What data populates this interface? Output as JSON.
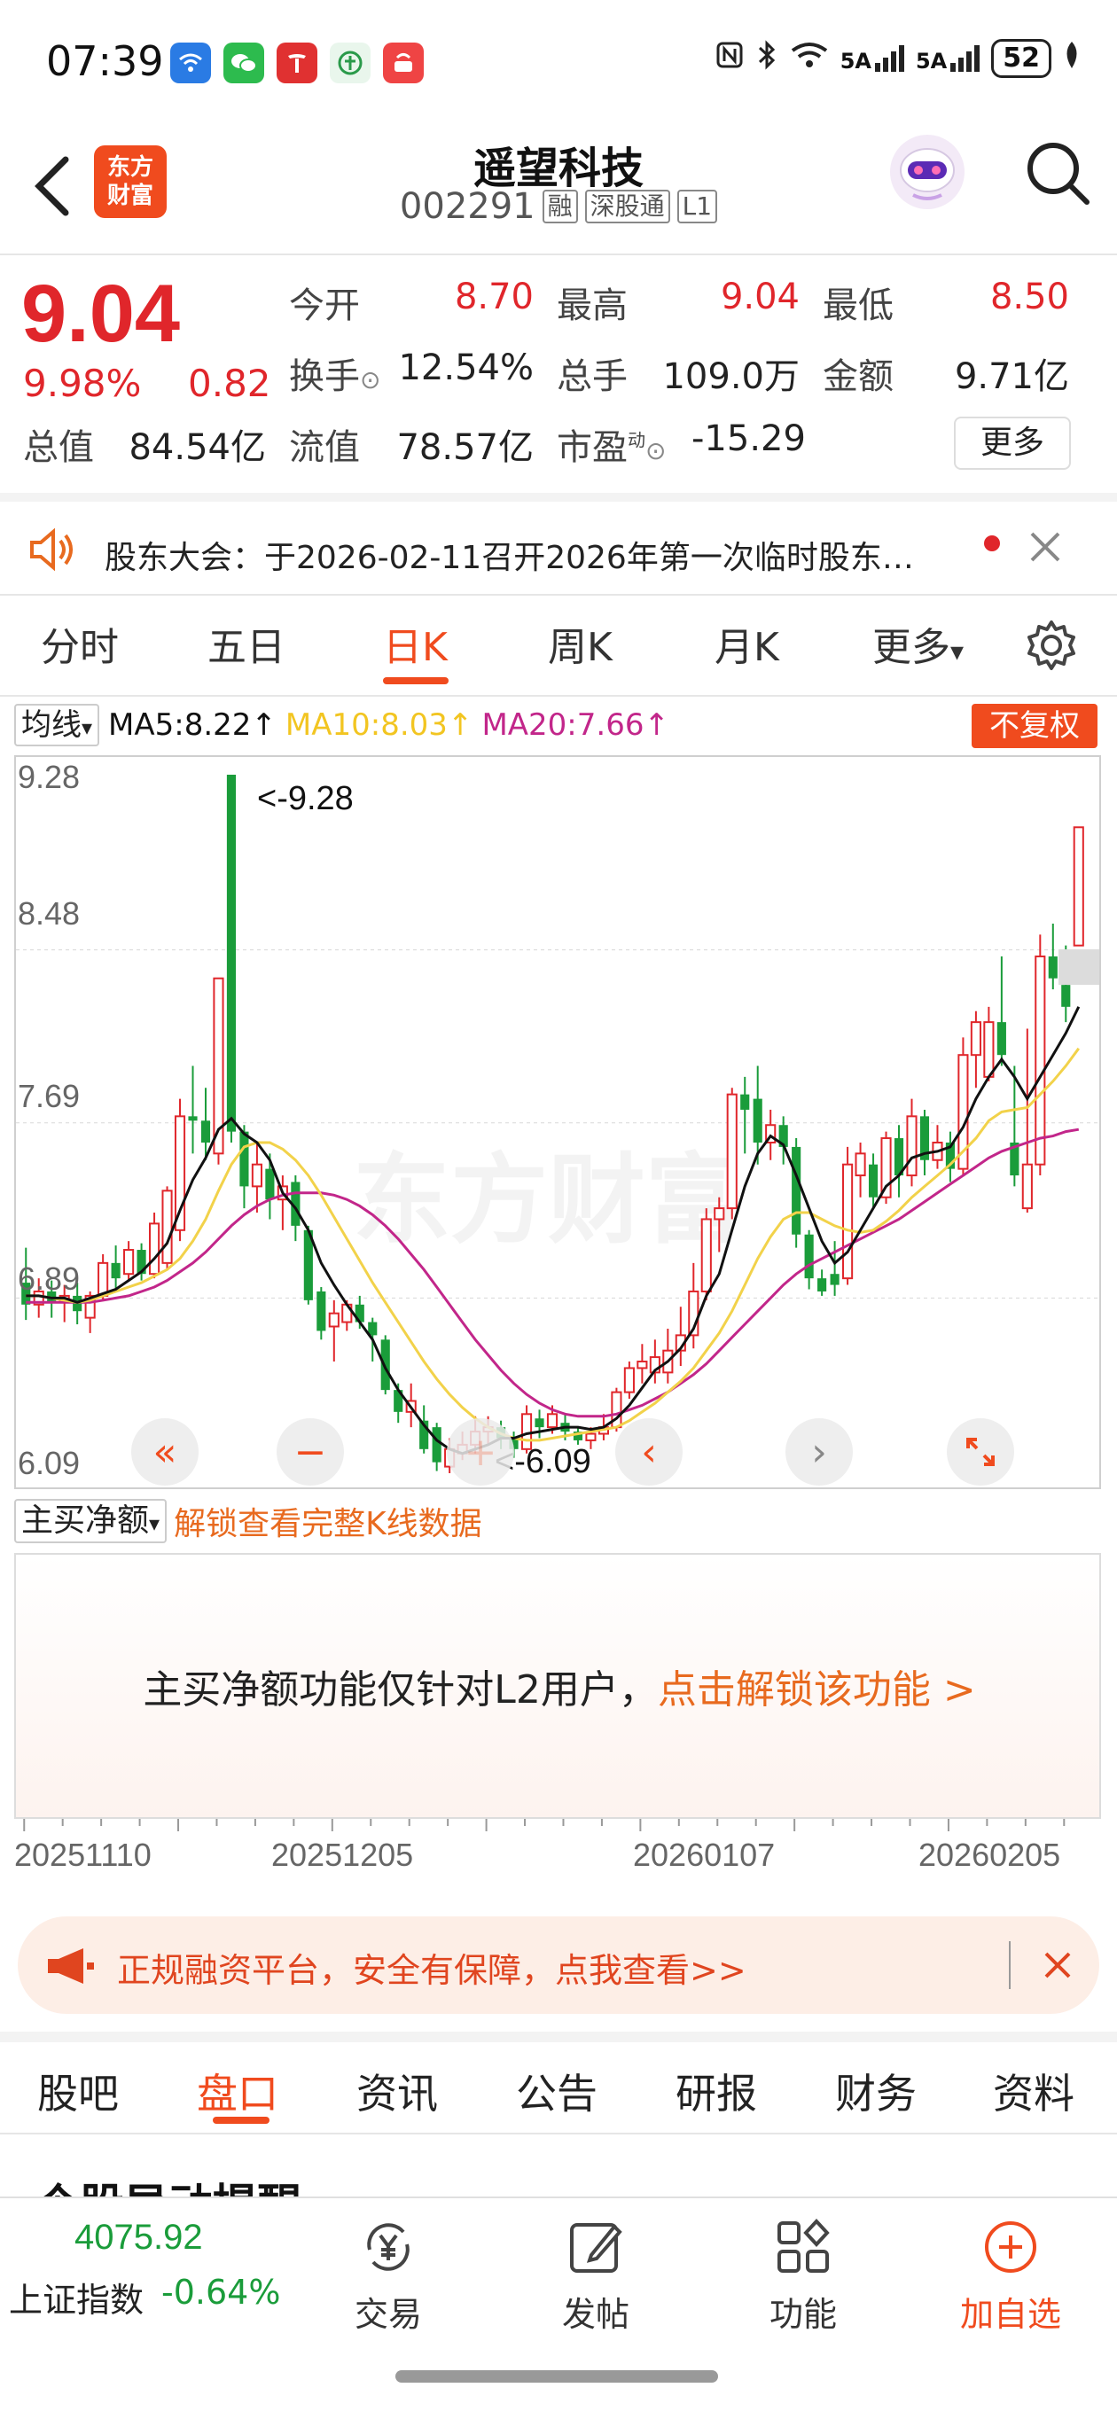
{
  "status_bar": {
    "time": "07:39",
    "network": "5A",
    "battery": "52"
  },
  "header": {
    "brand": "东方财富",
    "stock_name": "遥望科技",
    "stock_code": "002291",
    "tags": [
      "融",
      "深股通",
      "L1"
    ]
  },
  "quote": {
    "price": "9.04",
    "change_pct": "9.98%",
    "change": "0.82",
    "fields": [
      {
        "label": "今开",
        "value": "8.70",
        "color": "red"
      },
      {
        "label": "最高",
        "value": "9.04",
        "color": "red"
      },
      {
        "label": "最低",
        "value": "8.50",
        "color": "red"
      },
      {
        "label": "换手",
        "value": "12.54%",
        "color": "dark"
      },
      {
        "label": "总手",
        "value": "109.0万",
        "color": "dark"
      },
      {
        "label": "金额",
        "value": "9.71亿",
        "color": "dark"
      },
      {
        "label": "总值",
        "value": "84.54亿",
        "color": "dark"
      },
      {
        "label": "流值",
        "value": "78.57亿",
        "color": "dark"
      },
      {
        "label": "市盈",
        "value": "-15.29",
        "color": "dark"
      }
    ],
    "pe_superscript": "动",
    "more_label": "更多"
  },
  "notice": {
    "text": "股东大会：于2026-02-11召开2026年第一次临时股东…"
  },
  "period_tabs": {
    "items": [
      "分时",
      "五日",
      "日K",
      "周K",
      "月K",
      "更多"
    ],
    "active": "日K"
  },
  "ma_row": {
    "select_label": "均线",
    "ma5": "MA5:8.22↑",
    "ma10": "MA10:8.03↑",
    "ma20": "MA20:7.66↑",
    "unadjusted_label": "不复权"
  },
  "chart_data": {
    "type": "candlestick",
    "y_labels": [
      "9.28",
      "8.48",
      "7.69",
      "6.89",
      "6.09"
    ],
    "ylim": [
      6.09,
      9.28
    ],
    "high_annotation": "<-9.28",
    "low_annotation": "<-6.09",
    "candles": [
      {
        "o": 6.96,
        "c": 6.86,
        "h": 7.12,
        "l": 6.79
      },
      {
        "o": 6.86,
        "c": 6.92,
        "h": 6.98,
        "l": 6.8
      },
      {
        "o": 6.92,
        "c": 6.87,
        "h": 6.97,
        "l": 6.8
      },
      {
        "o": 6.87,
        "c": 6.9,
        "h": 6.95,
        "l": 6.78
      },
      {
        "o": 6.9,
        "c": 6.83,
        "h": 6.96,
        "l": 6.77
      },
      {
        "o": 6.8,
        "c": 6.9,
        "h": 6.92,
        "l": 6.73
      },
      {
        "o": 6.9,
        "c": 7.05,
        "h": 7.09,
        "l": 6.88
      },
      {
        "o": 7.05,
        "c": 6.98,
        "h": 7.13,
        "l": 6.92
      },
      {
        "o": 7.0,
        "c": 7.11,
        "h": 7.15,
        "l": 6.97
      },
      {
        "o": 7.11,
        "c": 7.0,
        "h": 7.14,
        "l": 6.97
      },
      {
        "o": 7.0,
        "c": 7.23,
        "h": 7.28,
        "l": 6.98
      },
      {
        "o": 7.05,
        "c": 7.38,
        "h": 7.4,
        "l": 7.02
      },
      {
        "o": 7.2,
        "c": 7.72,
        "h": 7.8,
        "l": 7.15
      },
      {
        "o": 7.72,
        "c": 7.7,
        "h": 7.95,
        "l": 7.55
      },
      {
        "o": 7.7,
        "c": 7.6,
        "h": 7.85,
        "l": 7.52
      },
      {
        "o": 7.55,
        "c": 8.35,
        "h": 8.35,
        "l": 7.5
      },
      {
        "o": 9.28,
        "c": 7.65,
        "h": 9.28,
        "l": 7.6
      },
      {
        "o": 7.65,
        "c": 7.4,
        "h": 7.68,
        "l": 7.3
      },
      {
        "o": 7.4,
        "c": 7.5,
        "h": 7.6,
        "l": 7.28
      },
      {
        "o": 7.48,
        "c": 7.34,
        "h": 7.55,
        "l": 7.25
      },
      {
        "o": 7.34,
        "c": 7.4,
        "h": 7.45,
        "l": 7.2
      },
      {
        "o": 7.42,
        "c": 7.22,
        "h": 7.45,
        "l": 7.15
      },
      {
        "o": 7.2,
        "c": 6.88,
        "h": 7.22,
        "l": 6.86
      },
      {
        "o": 6.92,
        "c": 6.74,
        "h": 6.94,
        "l": 6.7
      },
      {
        "o": 6.76,
        "c": 6.82,
        "h": 6.88,
        "l": 6.6
      },
      {
        "o": 6.78,
        "c": 6.86,
        "h": 6.88,
        "l": 6.74
      },
      {
        "o": 6.86,
        "c": 6.78,
        "h": 6.9,
        "l": 6.75
      },
      {
        "o": 6.78,
        "c": 6.72,
        "h": 6.8,
        "l": 6.6
      },
      {
        "o": 6.7,
        "c": 6.47,
        "h": 6.72,
        "l": 6.45
      },
      {
        "o": 6.47,
        "c": 6.37,
        "h": 6.5,
        "l": 6.32
      },
      {
        "o": 6.37,
        "c": 6.42,
        "h": 6.5,
        "l": 6.3
      },
      {
        "o": 6.33,
        "c": 6.2,
        "h": 6.4,
        "l": 6.18
      },
      {
        "o": 6.3,
        "c": 6.14,
        "h": 6.32,
        "l": 6.1
      },
      {
        "o": 6.12,
        "c": 6.2,
        "h": 6.25,
        "l": 6.09
      },
      {
        "o": 6.18,
        "c": 6.22,
        "h": 6.28,
        "l": 6.15
      },
      {
        "o": 6.22,
        "c": 6.28,
        "h": 6.35,
        "l": 6.18
      },
      {
        "o": 6.28,
        "c": 6.3,
        "h": 6.35,
        "l": 6.22
      },
      {
        "o": 6.3,
        "c": 6.25,
        "h": 6.33,
        "l": 6.2
      },
      {
        "o": 6.25,
        "c": 6.2,
        "h": 6.28,
        "l": 6.16
      },
      {
        "o": 6.2,
        "c": 6.36,
        "h": 6.4,
        "l": 6.18
      },
      {
        "o": 6.34,
        "c": 6.3,
        "h": 6.38,
        "l": 6.25
      },
      {
        "o": 6.3,
        "c": 6.36,
        "h": 6.4,
        "l": 6.27
      },
      {
        "o": 6.32,
        "c": 6.28,
        "h": 6.36,
        "l": 6.24
      },
      {
        "o": 6.28,
        "c": 6.24,
        "h": 6.3,
        "l": 6.22
      },
      {
        "o": 6.24,
        "c": 6.27,
        "h": 6.3,
        "l": 6.2
      },
      {
        "o": 6.27,
        "c": 6.3,
        "h": 6.36,
        "l": 6.24
      },
      {
        "o": 6.3,
        "c": 6.46,
        "h": 6.48,
        "l": 6.28
      },
      {
        "o": 6.46,
        "c": 6.57,
        "h": 6.6,
        "l": 6.43
      },
      {
        "o": 6.57,
        "c": 6.6,
        "h": 6.68,
        "l": 6.5
      },
      {
        "o": 6.55,
        "c": 6.62,
        "h": 6.7,
        "l": 6.5
      },
      {
        "o": 6.55,
        "c": 6.65,
        "h": 6.75,
        "l": 6.5
      },
      {
        "o": 6.65,
        "c": 6.72,
        "h": 6.85,
        "l": 6.58
      },
      {
        "o": 6.72,
        "c": 6.92,
        "h": 7.05,
        "l": 6.66
      },
      {
        "o": 6.92,
        "c": 7.25,
        "h": 7.3,
        "l": 6.88
      },
      {
        "o": 7.25,
        "c": 7.3,
        "h": 7.35,
        "l": 7.1
      },
      {
        "o": 7.3,
        "c": 7.82,
        "h": 7.85,
        "l": 7.25
      },
      {
        "o": 7.82,
        "c": 7.75,
        "h": 7.9,
        "l": 7.55
      },
      {
        "o": 7.8,
        "c": 7.6,
        "h": 7.95,
        "l": 7.5
      },
      {
        "o": 7.6,
        "c": 7.68,
        "h": 7.75,
        "l": 7.52
      },
      {
        "o": 7.68,
        "c": 7.58,
        "h": 7.72,
        "l": 7.5
      },
      {
        "o": 7.58,
        "c": 7.18,
        "h": 7.62,
        "l": 7.12
      },
      {
        "o": 7.18,
        "c": 6.98,
        "h": 7.2,
        "l": 6.93
      },
      {
        "o": 6.98,
        "c": 6.92,
        "h": 7.02,
        "l": 6.9
      },
      {
        "o": 7.0,
        "c": 6.95,
        "h": 7.15,
        "l": 6.9
      },
      {
        "o": 6.98,
        "c": 7.5,
        "h": 7.58,
        "l": 6.95
      },
      {
        "o": 7.45,
        "c": 7.55,
        "h": 7.6,
        "l": 7.35
      },
      {
        "o": 7.5,
        "c": 7.35,
        "h": 7.55,
        "l": 7.3
      },
      {
        "o": 7.35,
        "c": 7.62,
        "h": 7.65,
        "l": 7.32
      },
      {
        "o": 7.62,
        "c": 7.45,
        "h": 7.68,
        "l": 7.35
      },
      {
        "o": 7.45,
        "c": 7.72,
        "h": 7.8,
        "l": 7.4
      },
      {
        "o": 7.72,
        "c": 7.52,
        "h": 7.75,
        "l": 7.45
      },
      {
        "o": 7.52,
        "c": 7.6,
        "h": 7.68,
        "l": 7.48
      },
      {
        "o": 7.6,
        "c": 7.48,
        "h": 7.65,
        "l": 7.42
      },
      {
        "o": 7.48,
        "c": 8.0,
        "h": 8.08,
        "l": 7.45
      },
      {
        "o": 8.0,
        "c": 8.15,
        "h": 8.2,
        "l": 7.85
      },
      {
        "o": 7.9,
        "c": 8.15,
        "h": 8.22,
        "l": 7.88
      },
      {
        "o": 8.15,
        "c": 8.0,
        "h": 8.45,
        "l": 7.95
      },
      {
        "o": 7.6,
        "c": 7.45,
        "h": 7.95,
        "l": 7.4
      },
      {
        "o": 7.3,
        "c": 7.5,
        "h": 8.12,
        "l": 7.28
      },
      {
        "o": 7.5,
        "c": 8.45,
        "h": 8.55,
        "l": 7.45
      },
      {
        "o": 8.45,
        "c": 8.35,
        "h": 8.6,
        "l": 8.3
      },
      {
        "o": 8.32,
        "c": 8.22,
        "h": 8.5,
        "l": 8.15
      },
      {
        "o": 8.5,
        "c": 9.04,
        "h": 9.04,
        "l": 8.5
      }
    ],
    "ma5": [
      6.9,
      6.9,
      6.89,
      6.89,
      6.87,
      6.89,
      6.91,
      6.93,
      6.97,
      7.01,
      7.07,
      7.14,
      7.29,
      7.43,
      7.53,
      7.66,
      7.71,
      7.64,
      7.6,
      7.52,
      7.37,
      7.3,
      7.2,
      7.05,
      6.95,
      6.86,
      6.78,
      6.7,
      6.57,
      6.47,
      6.39,
      6.31,
      6.24,
      6.2,
      6.18,
      6.2,
      6.22,
      6.25,
      6.25,
      6.27,
      6.28,
      6.29,
      6.3,
      6.3,
      6.29,
      6.3,
      6.34,
      6.4,
      6.48,
      6.56,
      6.6,
      6.66,
      6.75,
      6.9,
      7.0,
      7.2,
      7.4,
      7.55,
      7.63,
      7.59,
      7.45,
      7.3,
      7.15,
      7.05,
      7.1,
      7.2,
      7.3,
      7.4,
      7.45,
      7.53,
      7.55,
      7.56,
      7.58,
      7.67,
      7.8,
      7.9,
      7.98,
      7.9,
      7.8,
      7.9,
      8.0,
      8.1,
      8.22
    ],
    "ma10": [
      6.9,
      6.9,
      6.89,
      6.88,
      6.87,
      6.88,
      6.9,
      6.92,
      6.94,
      6.96,
      6.99,
      7.02,
      7.07,
      7.15,
      7.25,
      7.38,
      7.5,
      7.58,
      7.6,
      7.6,
      7.57,
      7.52,
      7.45,
      7.36,
      7.26,
      7.16,
      7.06,
      6.96,
      6.87,
      6.78,
      6.69,
      6.6,
      6.52,
      6.45,
      6.39,
      6.34,
      6.3,
      6.27,
      6.25,
      6.24,
      6.24,
      6.25,
      6.26,
      6.27,
      6.28,
      6.29,
      6.3,
      6.33,
      6.37,
      6.41,
      6.46,
      6.51,
      6.57,
      6.65,
      6.73,
      6.83,
      6.95,
      7.07,
      7.17,
      7.25,
      7.28,
      7.28,
      7.25,
      7.22,
      7.2,
      7.19,
      7.2,
      7.24,
      7.29,
      7.35,
      7.4,
      7.45,
      7.5,
      7.56,
      7.62,
      7.7,
      7.74,
      7.75,
      7.76,
      7.82,
      7.88,
      7.95,
      8.03
    ],
    "ma20": [
      6.87,
      6.87,
      6.87,
      6.87,
      6.87,
      6.87,
      6.88,
      6.89,
      6.9,
      6.92,
      6.94,
      6.97,
      7.01,
      7.05,
      7.1,
      7.16,
      7.22,
      7.27,
      7.31,
      7.34,
      7.36,
      7.37,
      7.37,
      7.37,
      7.36,
      7.34,
      7.31,
      7.27,
      7.22,
      7.16,
      7.09,
      7.02,
      6.94,
      6.86,
      6.78,
      6.7,
      6.63,
      6.56,
      6.5,
      6.45,
      6.41,
      6.38,
      6.36,
      6.35,
      6.35,
      6.35,
      6.36,
      6.38,
      6.4,
      6.43,
      6.46,
      6.5,
      6.54,
      6.59,
      6.65,
      6.71,
      6.77,
      6.83,
      6.89,
      6.95,
      7.0,
      7.04,
      7.07,
      7.1,
      7.13,
      7.16,
      7.19,
      7.22,
      7.25,
      7.29,
      7.33,
      7.37,
      7.41,
      7.45,
      7.49,
      7.53,
      7.56,
      7.58,
      7.6,
      7.62,
      7.63,
      7.65,
      7.66
    ]
  },
  "net_flow": {
    "select_label": "主买净额",
    "unlock_link": "解锁查看完整K线数据",
    "l2_prefix": "主买净额功能仅针对L2用户，",
    "l2_link": "点击解锁该功能 >"
  },
  "date_axis": [
    "20251110",
    "20251205",
    "20260107",
    "20260205"
  ],
  "ad": {
    "text": "正规融资平台，安全有保障，点我查看>>"
  },
  "sub_tabs": {
    "items": [
      "股吧",
      "盘口",
      "资讯",
      "公告",
      "研报",
      "财务",
      "资料"
    ],
    "active": "盘口"
  },
  "partial_heading": "个股异动提醒",
  "bottom_bar": {
    "index_value": "4075.92",
    "index_name": "上证指数",
    "index_change": "-0.64%",
    "items": [
      "交易",
      "发帖",
      "功能",
      "加自选"
    ]
  },
  "colors": {
    "accent": "#f04b1e",
    "up_red": "#e0262b",
    "down_green": "#1a9c3a",
    "ma5": "#111111",
    "ma10": "#f2d24a",
    "ma20": "#c2268a"
  }
}
